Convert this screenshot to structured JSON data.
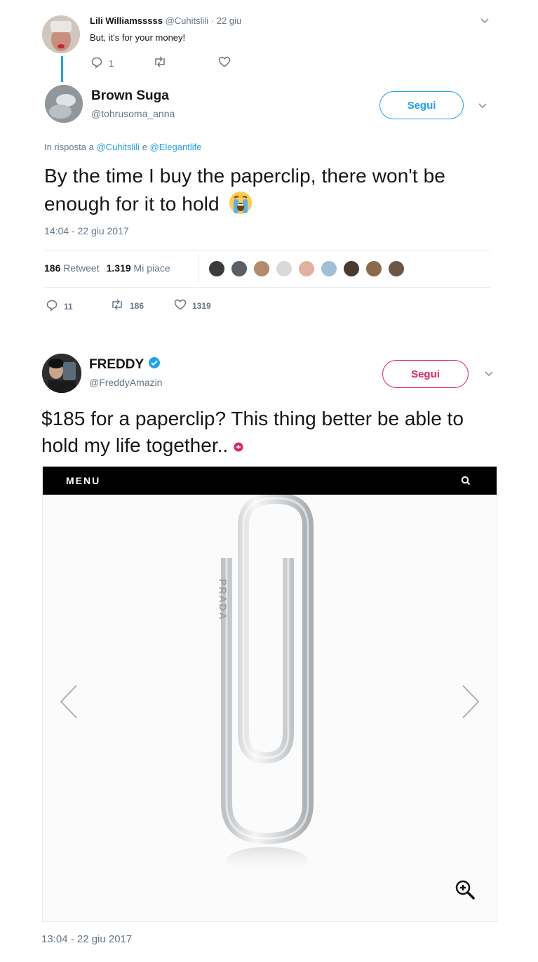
{
  "tweet1": {
    "name": "Lili Williamsssss",
    "handle_time": "@Cuhitslili · 22 giu",
    "text": "But, it's for your money!",
    "reply_count": "1"
  },
  "tweet2": {
    "name": "Brown Suga",
    "handle": "@tohrusoma_anna",
    "follow_label": "Segui",
    "reply_to_prefix": "In risposta a",
    "reply_to_user1": "@Cuhitslili",
    "reply_to_and": "e",
    "reply_to_user2": "@Elegantlife",
    "text": "By the time I buy the paperclip, there won't be enough for it to hold",
    "timestamp": "14:04 - 22 giu 2017",
    "retweets_num": "186",
    "retweets_label": "Retweet",
    "likes_num": "1.319",
    "likes_label": "Mi piace",
    "reply_count": "11",
    "retweet_count": "186",
    "like_count": "1319",
    "liker_colors": [
      "#3b3b3b",
      "#5a5f66",
      "#b58a6a",
      "#d9d9d9",
      "#e2b2a1",
      "#9ec1d9",
      "#4a3a30",
      "#8a6a4a",
      "#6b5748"
    ]
  },
  "tweet3": {
    "name": "FREDDY",
    "handle": "@FreddyAmazin",
    "follow_label": "Segui",
    "text": "$185 for a paperclip? This thing better be able to hold my life together..",
    "timestamp": "13:04 - 22 giu 2017",
    "media": {
      "menu_label": "MENU",
      "brand_engraving": "PRADA"
    }
  },
  "colors": {
    "accent_blue": "#1da1f2",
    "follow_red": "#e0245e",
    "muted_text": "#657786"
  }
}
